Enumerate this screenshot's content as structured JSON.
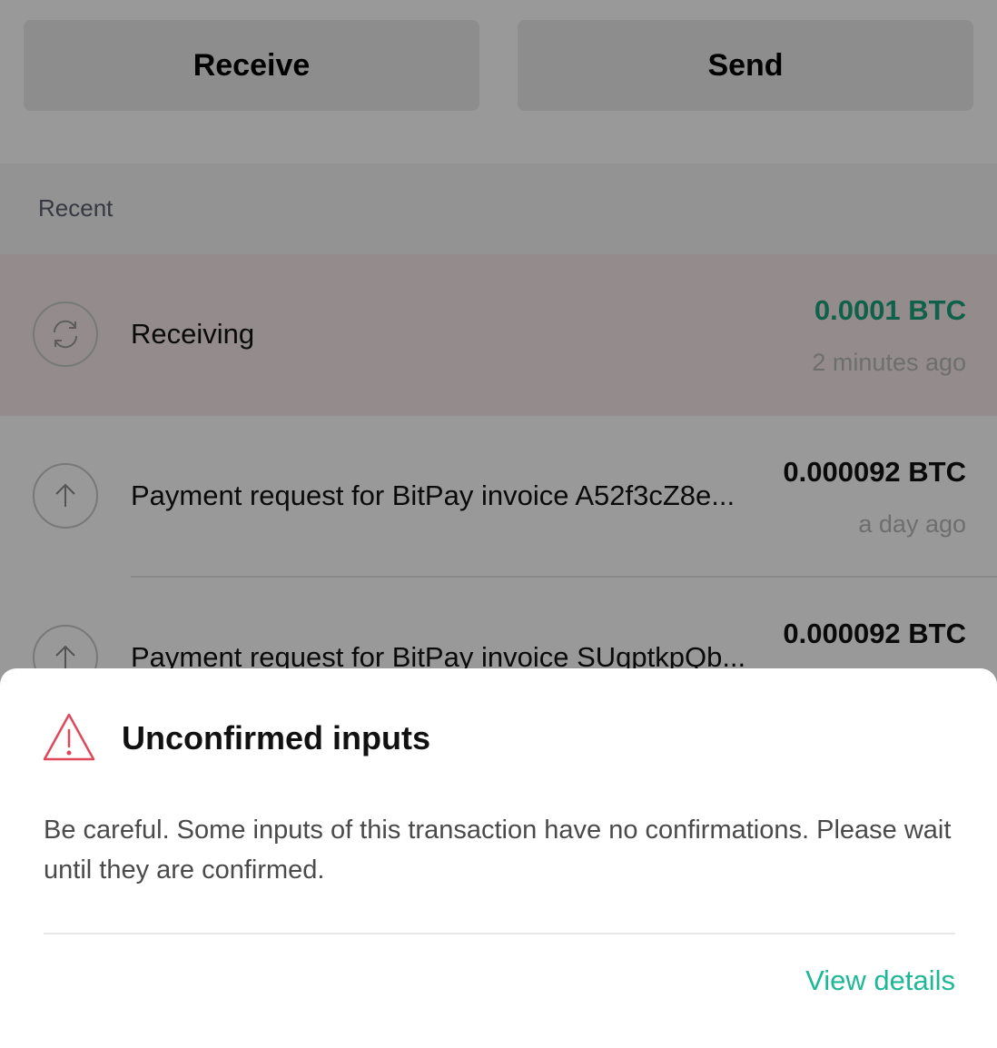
{
  "actions": {
    "receive_label": "Receive",
    "send_label": "Send"
  },
  "recent": {
    "section_label": "Recent",
    "transactions": [
      {
        "icon": "sync-icon",
        "title": "Receiving",
        "amount": "0.0001 BTC",
        "time": "2 minutes ago",
        "amount_color": "#1aa37a"
      },
      {
        "icon": "arrow-up-icon",
        "title": "Payment request for BitPay invoice A52f3cZ8e...",
        "amount": "0.000092 BTC",
        "time": "a day ago"
      },
      {
        "icon": "arrow-up-icon",
        "title": "Payment request for BitPay invoice SUqptkpQb...",
        "amount": "0.000092 BTC",
        "time": ""
      }
    ]
  },
  "sheet": {
    "icon": "warning-triangle-icon",
    "title": "Unconfirmed inputs",
    "message": "Be careful. Some inputs of this transaction have no confirmations. Please wait until they are confirmed.",
    "action_label": "View details",
    "accent_color": "#1fb896",
    "warning_color": "#e0475b"
  }
}
